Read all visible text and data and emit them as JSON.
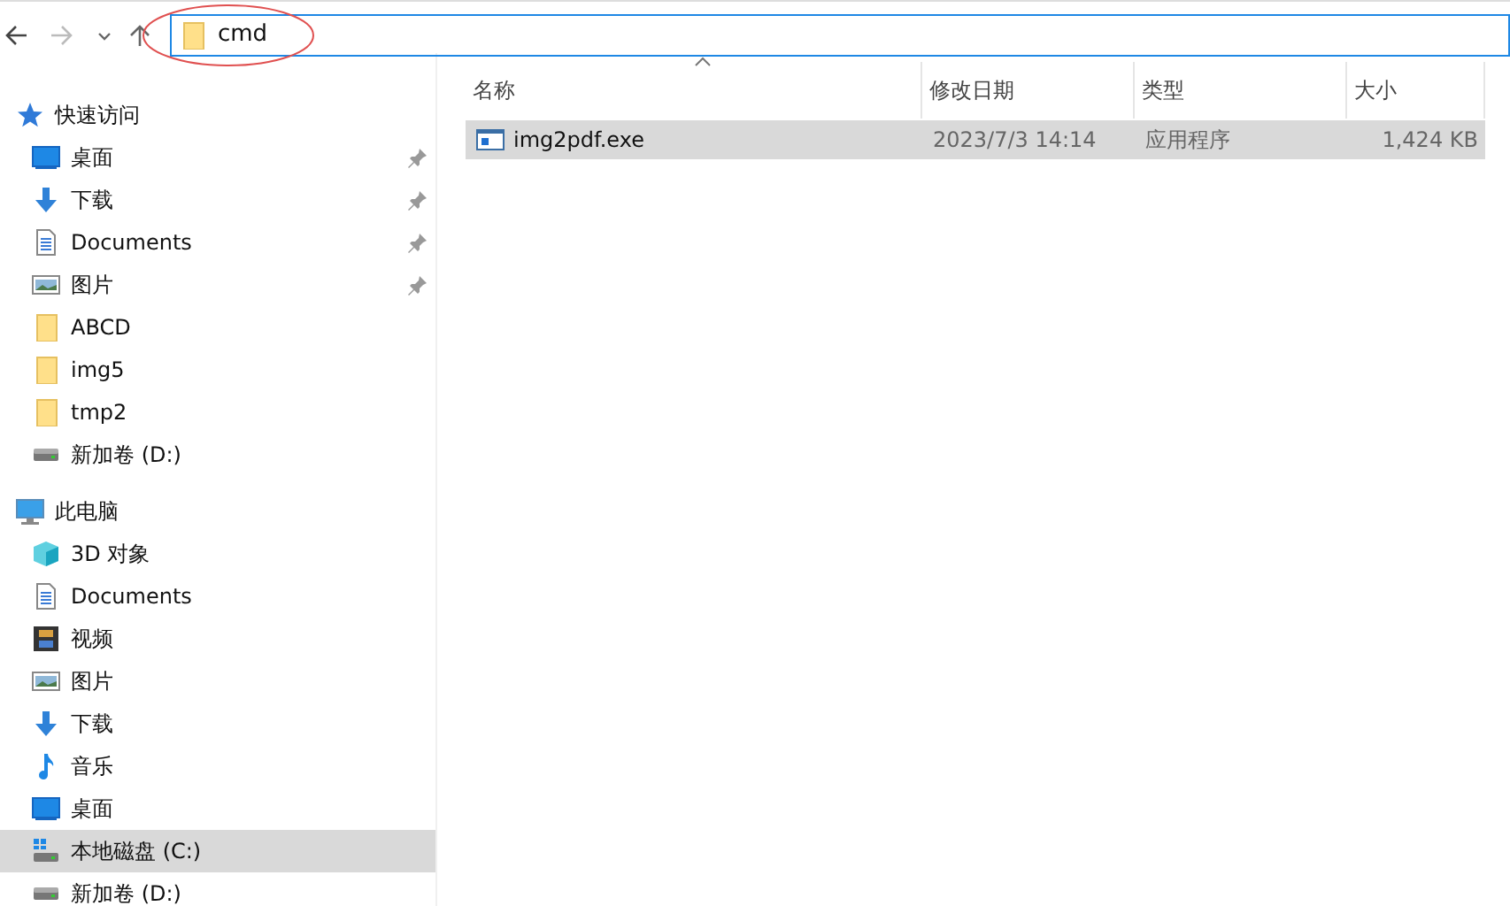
{
  "address_bar": {
    "path": "cmd",
    "annotated": true
  },
  "navigation": [
    {
      "label": "快速访问",
      "kind": "star",
      "children": [
        {
          "label": "桌面",
          "kind": "desktop",
          "pinned": true,
          "selected": false
        },
        {
          "label": "下载",
          "kind": "download",
          "pinned": true,
          "selected": false
        },
        {
          "label": "Documents",
          "kind": "document",
          "pinned": true,
          "selected": false
        },
        {
          "label": "图片",
          "kind": "picture",
          "pinned": true,
          "selected": false
        },
        {
          "label": "ABCD",
          "kind": "folder",
          "pinned": false,
          "selected": false
        },
        {
          "label": "img5",
          "kind": "folder",
          "pinned": false,
          "selected": false
        },
        {
          "label": "tmp2",
          "kind": "folder",
          "pinned": false,
          "selected": false
        },
        {
          "label": "新加卷 (D:)",
          "kind": "drive",
          "pinned": false,
          "selected": false
        }
      ]
    },
    {
      "label": "此电脑",
      "kind": "computer",
      "children": [
        {
          "label": "3D 对象",
          "kind": "cube",
          "pinned": false,
          "selected": false
        },
        {
          "label": "Documents",
          "kind": "document",
          "pinned": false,
          "selected": false
        },
        {
          "label": "视频",
          "kind": "video",
          "pinned": false,
          "selected": false
        },
        {
          "label": "图片",
          "kind": "picture",
          "pinned": false,
          "selected": false
        },
        {
          "label": "下载",
          "kind": "download",
          "pinned": false,
          "selected": false
        },
        {
          "label": "音乐",
          "kind": "music",
          "pinned": false,
          "selected": false
        },
        {
          "label": "桌面",
          "kind": "desktop",
          "pinned": false,
          "selected": false
        },
        {
          "label": "本地磁盘 (C:)",
          "kind": "windrive",
          "pinned": false,
          "selected": true
        },
        {
          "label": "新加卷 (D:)",
          "kind": "drive",
          "pinned": false,
          "selected": false
        }
      ]
    }
  ],
  "table": {
    "columns": [
      {
        "label": "名称",
        "sorted": true
      },
      {
        "label": "修改日期",
        "sorted": false
      },
      {
        "label": "类型",
        "sorted": false
      },
      {
        "label": "大小",
        "sorted": false
      }
    ],
    "rows": [
      {
        "name": "img2pdf.exe",
        "modified": "2023/7/3 14:14",
        "type": "应用程序",
        "size": "1,424 KB",
        "selected": true
      }
    ]
  }
}
